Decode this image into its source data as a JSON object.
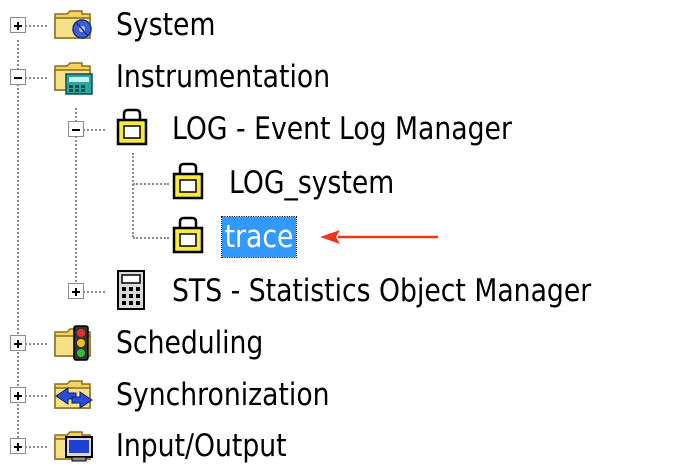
{
  "tree": {
    "items": [
      {
        "label": "System",
        "icon": "system-folder-icon",
        "expander": "plus"
      },
      {
        "label": "Instrumentation",
        "icon": "instrumentation-folder-icon",
        "expander": "minus"
      },
      {
        "label": "LOG - Event Log Manager",
        "icon": "log-manager-icon",
        "expander": "minus"
      },
      {
        "label": "LOG_system",
        "icon": "log-object-icon",
        "expander": "none"
      },
      {
        "label": "trace",
        "icon": "log-object-icon",
        "expander": "none",
        "selected": true
      },
      {
        "label": "STS - Statistics Object Manager",
        "icon": "calculator-icon",
        "expander": "plus"
      },
      {
        "label": "Scheduling",
        "icon": "scheduling-folder-icon",
        "expander": "plus"
      },
      {
        "label": "Synchronization",
        "icon": "synchronization-folder-icon",
        "expander": "plus"
      },
      {
        "label": "Input/Output",
        "icon": "io-folder-icon",
        "expander": "plus"
      }
    ]
  },
  "colors": {
    "selection": "#3399ff",
    "arrow": "#e8391d",
    "tree_lines": "#8c8c8c"
  }
}
